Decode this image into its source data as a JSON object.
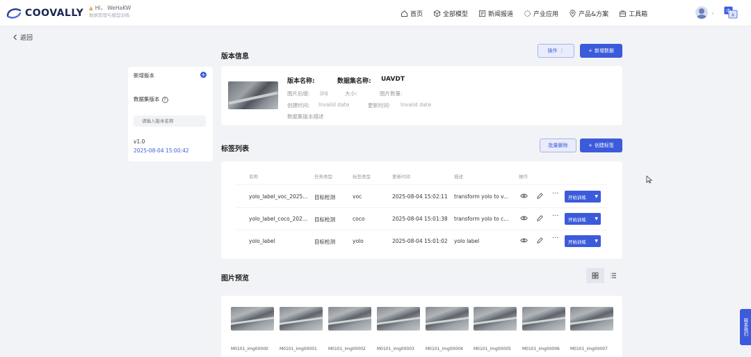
{
  "header": {
    "logo_text": "COOVALLY",
    "greeting": "Hi，  WeHaKW",
    "greeting_sub": "数据管理与模型训练",
    "nav": [
      {
        "label": "首页",
        "icon": "home-icon"
      },
      {
        "label": "全部模型",
        "icon": "cube-icon"
      },
      {
        "label": "新闻报道",
        "icon": "news-icon"
      },
      {
        "label": "产业应用",
        "icon": "industry-icon"
      },
      {
        "label": "产品&方案",
        "icon": "location-icon"
      },
      {
        "label": "工具箱",
        "icon": "toolbox-icon"
      }
    ],
    "lang_label": "中",
    "user_caret": "⌄"
  },
  "back_label": "返回",
  "sidebar": {
    "add_version": "新增版本",
    "add_symbol": "+",
    "dataset_version": "数据集版本",
    "help_symbol": "?",
    "search_placeholder": "请输入版本名称",
    "version_name": "v1.0",
    "version_date": "2025-08-04 15:00:42"
  },
  "version_info": {
    "title": "版本信息",
    "actions_button": "操作",
    "new_data_button": "新增数据",
    "version_name_label": "版本名称:",
    "dataset_name_label": "数据集名称:",
    "dataset_name_value": "UAVDT",
    "image_suffix_label": "图片后缀:",
    "image_suffix_value": "jpg",
    "size_label": "大小:",
    "image_count_label": "图片数量:",
    "created_label": "创建时间:",
    "created_value": "Invalid date",
    "updated_label": "更新时间:",
    "updated_value": "Invalid date",
    "description_label": "数据集版本描述"
  },
  "labels": {
    "title": "标签列表",
    "batch_delete_button": "批量删除",
    "create_label_button": "创建标签",
    "columns": [
      "名称",
      "任务类型",
      "标签类型",
      "更新时间",
      "描述",
      "操作"
    ],
    "rows": [
      {
        "name": "yolo_label_voc_2025...",
        "task": "目标检测",
        "type": "voc",
        "updated": "2025-08-04 15:02:11",
        "desc": "transform yolo to v...",
        "train": "开始训练"
      },
      {
        "name": "yolo_label_coco_202...",
        "task": "目标检测",
        "type": "coco",
        "updated": "2025-08-04 15:01:38",
        "desc": "transform yolo to c...",
        "train": "开始训练"
      },
      {
        "name": "yolo_label",
        "task": "目标检测",
        "type": "yolo",
        "updated": "2025-08-04 15:01:02",
        "desc": "yolo label",
        "train": "开始训练"
      }
    ]
  },
  "preview": {
    "title": "图片预览",
    "images": [
      "M0101_img00000",
      "M0101_img00001",
      "M0101_img00002",
      "M0101_img00003",
      "M0101_img00004",
      "M0101_img00005",
      "M0101_img00006",
      "M0101_img00007"
    ]
  },
  "float_side_label": "联系我们",
  "colors": {
    "primary": "#3b5bdb",
    "background": "#f2f3f6"
  }
}
